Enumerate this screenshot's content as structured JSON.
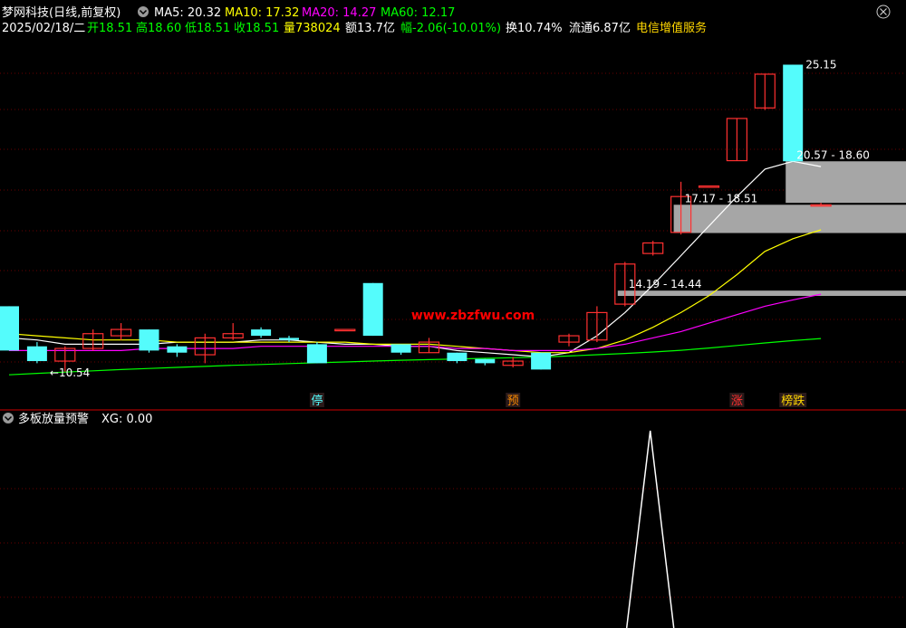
{
  "header": {
    "stock_title": "梦网科技(日线,前复权)",
    "ma5": "MA5: 20.32",
    "ma10": "MA10: 17.32",
    "ma20": "MA20: 14.27",
    "ma60": "MA60: 12.17",
    "date": "2025/02/18/二",
    "open": "开18.51",
    "high": "高18.60",
    "low": "低18.51",
    "close": "收18.51",
    "volume": "量738024",
    "amount": "额13.7亿",
    "change": "幅-2.06(-10.01%)",
    "turnover": "换10.74%",
    "float_cap": "流通6.87亿",
    "sector": "电信增值服务"
  },
  "indicator": {
    "title": "多板放量预警",
    "value": "XG: 0.00"
  },
  "watermark": "www.zbzfwu.com",
  "colors": {
    "background": "#000000",
    "up": "#ff3030",
    "down": "#54fcfc",
    "ma5": "#ffffff",
    "ma10": "#ffff00",
    "ma20": "#ff00ff",
    "ma60": "#00ff00",
    "zone": "#a6a6a6",
    "grid": "#8b0000"
  },
  "chart_data": {
    "type": "candlestick",
    "y_range": [
      9.0,
      26.5
    ],
    "candles": [
      {
        "o": 13.7,
        "h": 13.7,
        "l": 11.6,
        "c": 11.6
      },
      {
        "o": 11.8,
        "h": 12.0,
        "l": 11.0,
        "c": 11.1
      },
      {
        "o": 11.1,
        "h": 11.8,
        "l": 10.6,
        "c": 11.7
      },
      {
        "o": 11.7,
        "h": 12.6,
        "l": 11.6,
        "c": 12.4
      },
      {
        "o": 12.3,
        "h": 12.9,
        "l": 12.1,
        "c": 12.6
      },
      {
        "o": 12.6,
        "h": 12.6,
        "l": 11.5,
        "c": 11.6
      },
      {
        "o": 11.8,
        "h": 11.9,
        "l": 11.3,
        "c": 11.5
      },
      {
        "o": 11.4,
        "h": 12.4,
        "l": 11.0,
        "c": 12.2
      },
      {
        "o": 12.2,
        "h": 12.9,
        "l": 12.1,
        "c": 12.4
      },
      {
        "o": 12.6,
        "h": 12.7,
        "l": 12.2,
        "c": 12.3
      },
      {
        "o": 12.2,
        "h": 12.3,
        "l": 12.0,
        "c": 12.1
      },
      {
        "o": 11.9,
        "h": 12.0,
        "l": 11.0,
        "c": 11.0
      },
      {
        "o": 12.6,
        "h": 12.6,
        "l": 12.6,
        "c": 12.6
      },
      {
        "o": 14.8,
        "h": 14.8,
        "l": 12.3,
        "c": 12.3
      },
      {
        "o": 11.9,
        "h": 11.9,
        "l": 11.4,
        "c": 11.5
      },
      {
        "o": 11.5,
        "h": 12.2,
        "l": 11.5,
        "c": 12.0
      },
      {
        "o": 11.5,
        "h": 11.5,
        "l": 11.0,
        "c": 11.1
      },
      {
        "o": 11.2,
        "h": 11.2,
        "l": 10.9,
        "c": 11.0
      },
      {
        "o": 10.9,
        "h": 11.3,
        "l": 10.8,
        "c": 11.1
      },
      {
        "o": 11.5,
        "h": 11.5,
        "l": 10.7,
        "c": 10.7
      },
      {
        "o": 12.0,
        "h": 12.4,
        "l": 11.8,
        "c": 12.3
      },
      {
        "o": 12.1,
        "h": 13.7,
        "l": 12.0,
        "c": 13.4
      },
      {
        "o": 13.8,
        "h": 15.8,
        "l": 13.7,
        "c": 15.7
      },
      {
        "o": 16.2,
        "h": 16.8,
        "l": 16.1,
        "c": 16.7
      },
      {
        "o": 17.2,
        "h": 19.6,
        "l": 17.1,
        "c": 18.9
      },
      {
        "o": 19.4,
        "h": 19.4,
        "l": 19.4,
        "c": 19.4
      },
      {
        "o": 20.6,
        "h": 22.6,
        "l": 20.6,
        "c": 22.6
      },
      {
        "o": 23.1,
        "h": 24.7,
        "l": 23.0,
        "c": 24.7
      },
      {
        "o": 25.15,
        "h": 25.15,
        "l": 20.57,
        "c": 20.57
      },
      {
        "o": 18.51,
        "h": 18.6,
        "l": 18.51,
        "c": 18.51
      }
    ],
    "ma_lines": [
      {
        "name": "MA5",
        "color": "#ffffff",
        "start": 0,
        "values": [
          12.2,
          12.1,
          11.9,
          11.9,
          11.9,
          11.9,
          12.0,
          12.0,
          12.0,
          12.1,
          12.1,
          12.0,
          11.9,
          11.9,
          11.8,
          11.8,
          11.6,
          11.5,
          11.4,
          11.3,
          11.5,
          12.3,
          13.4,
          14.7,
          16.1,
          17.5,
          18.9,
          20.2,
          20.57,
          20.32
        ]
      },
      {
        "name": "MA10",
        "color": "#ffff00",
        "start": 0,
        "values": [
          12.4,
          12.3,
          12.2,
          12.1,
          12.1,
          12.1,
          12.0,
          12.0,
          12.0,
          12.0,
          12.0,
          12.0,
          12.0,
          11.9,
          11.9,
          11.9,
          11.8,
          11.7,
          11.6,
          11.5,
          11.5,
          11.7,
          12.1,
          12.7,
          13.4,
          14.2,
          15.2,
          16.3,
          16.9,
          17.32
        ]
      },
      {
        "name": "MA20",
        "color": "#ff00ff",
        "start": 0,
        "values": [
          11.6,
          11.6,
          11.6,
          11.6,
          11.6,
          11.7,
          11.7,
          11.7,
          11.7,
          11.8,
          11.8,
          11.8,
          11.8,
          11.8,
          11.8,
          11.8,
          11.7,
          11.7,
          11.6,
          11.6,
          11.6,
          11.7,
          11.9,
          12.2,
          12.5,
          12.9,
          13.3,
          13.7,
          14.0,
          14.27
        ]
      },
      {
        "name": "MA60",
        "color": "#00ff00",
        "start": 0,
        "values": [
          10.45,
          10.52,
          10.58,
          10.64,
          10.7,
          10.75,
          10.8,
          10.85,
          10.9,
          10.94,
          10.98,
          11.02,
          11.06,
          11.1,
          11.14,
          11.17,
          11.2,
          11.23,
          11.26,
          11.29,
          11.34,
          11.4,
          11.46,
          11.53,
          11.61,
          11.72,
          11.84,
          11.96,
          12.07,
          12.17
        ]
      }
    ],
    "zones": [
      {
        "label": "20.57 - 18.60",
        "high": 20.57,
        "low": 18.6,
        "from": 28
      },
      {
        "label": "17.17 - 18.51",
        "high": 18.51,
        "low": 17.17,
        "from": 24
      },
      {
        "label": "14.19 - 14.44",
        "high": 14.44,
        "low": 14.19,
        "from": 22
      }
    ],
    "price_labels": [
      {
        "text": "25.15",
        "value": 25.15,
        "index": 28,
        "side": "right"
      },
      {
        "text": "10.54",
        "value": 10.54,
        "index": 1,
        "side": "right",
        "arrow": "←"
      }
    ],
    "markers": [
      {
        "text": "停",
        "index": 11,
        "color": "#54fcfc"
      },
      {
        "text": "预",
        "index": 18,
        "color": "#ff8c00"
      },
      {
        "text": "涨",
        "index": 26,
        "color": "#ff3030"
      },
      {
        "text": "榜跌",
        "index": 28,
        "color": "#ffd700"
      }
    ],
    "indicator_signal": {
      "peak_index": 23,
      "peak_value": 1,
      "range": [
        0,
        1
      ]
    }
  }
}
